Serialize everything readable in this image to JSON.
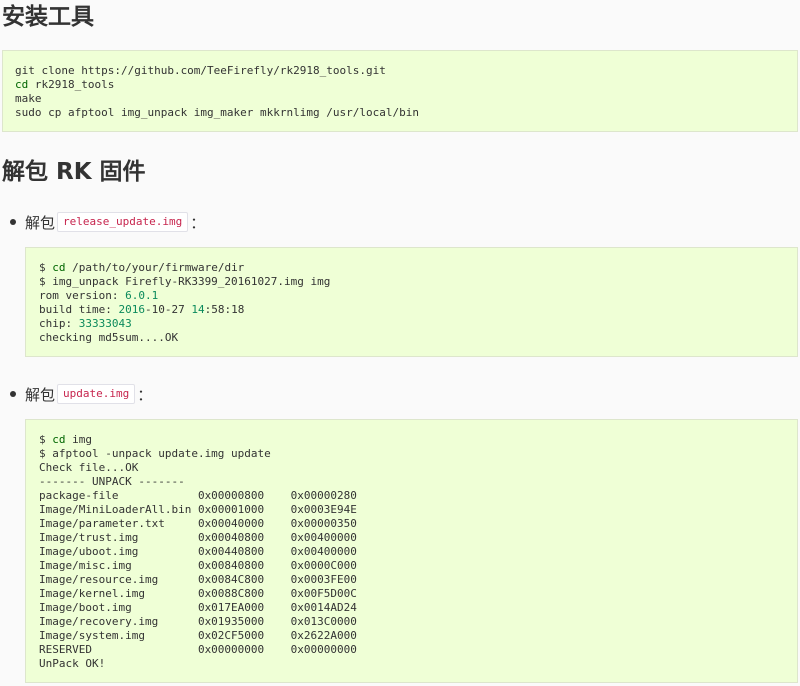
{
  "sections": {
    "install_title": "安装工具",
    "unpack_title": "解包 RK 固件"
  },
  "install_code": {
    "line1": "git clone https://github.com/TeeFirefly/rk2918_tools.git",
    "line2_kw": "cd",
    "line2_rest": " rk2918_tools",
    "line3": "make",
    "line4": "sudo cp afptool img_unpack img_maker mkkrnlimg /usr/local/bin"
  },
  "bullets": [
    {
      "prefix": "解包",
      "code": "release_update.img",
      "suffix": "："
    },
    {
      "prefix": "解包",
      "code": "update.img",
      "suffix": "："
    }
  ],
  "release_code": {
    "l1_prompt": "$ ",
    "l1_kw": "cd",
    "l1_rest": " /path/to/your/firmware/dir",
    "l2": "$ img_unpack Firefly-RK3399_20161027.img img",
    "l3_a": "rom version: ",
    "l3_num": "6.0.1",
    "l4_a": "build time: ",
    "l4_n1": "2016",
    "l4_b": "-10-27 ",
    "l4_n2": "14",
    "l4_c": ":58:18",
    "l5_a": "chip: ",
    "l5_num": "33333043",
    "l6": "checking md5sum....OK"
  },
  "update_code": {
    "l1_prompt": "$ ",
    "l1_kw": "cd",
    "l1_rest": " img",
    "l2": "$ afptool -unpack update.img update",
    "l3": "Check file...OK",
    "l4": "------- UNPACK -------",
    "rows": [
      "package-file            0x00000800    0x00000280",
      "Image/MiniLoaderAll.bin 0x00001000    0x0003E94E",
      "Image/parameter.txt     0x00040000    0x00000350",
      "Image/trust.img         0x00040800    0x00400000",
      "Image/uboot.img         0x00440800    0x00400000",
      "Image/misc.img          0x00840800    0x0000C000",
      "Image/resource.img      0x0084C800    0x0003FE00",
      "Image/kernel.img        0x0088C800    0x00F5D00C",
      "Image/boot.img          0x017EA000    0x0014AD24",
      "Image/recovery.img      0x01935000    0x013C0000",
      "Image/system.img        0x02CF5000    0x2622A000",
      "RESERVED                0x00000000    0x00000000"
    ],
    "last": "UnPack OK!"
  }
}
